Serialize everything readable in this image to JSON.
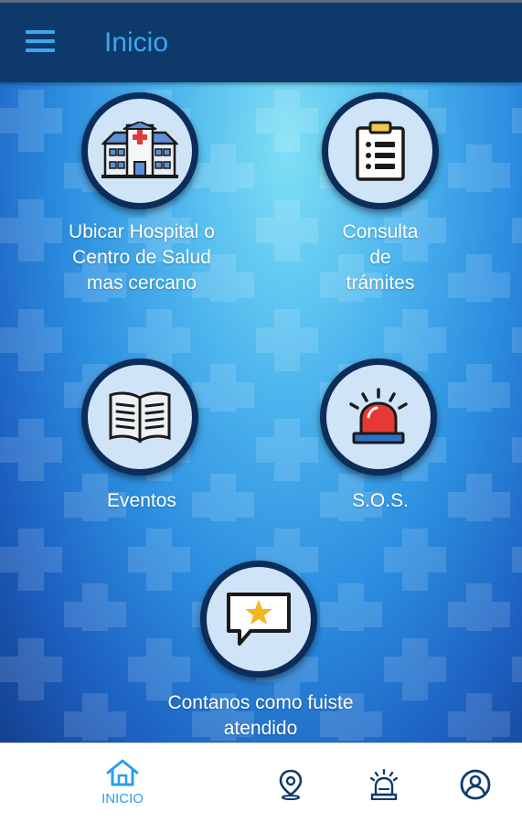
{
  "header": {
    "title": "Inicio",
    "menu_icon": "hamburger-menu-icon"
  },
  "tiles": [
    {
      "label_lines": [
        "Ubicar Hospital o",
        "Centro de Salud",
        "mas cercano"
      ],
      "icon": "hospital-icon"
    },
    {
      "label_lines": [
        "Consulta",
        "de",
        "trámites"
      ],
      "icon": "clipboard-icon"
    },
    {
      "label_lines": [
        "Eventos"
      ],
      "icon": "open-book-icon"
    },
    {
      "label_lines": [
        "S.O.S."
      ],
      "icon": "emergency-siren-icon"
    },
    {
      "label_lines": [
        "Contanos como fuiste",
        "atendido"
      ],
      "icon": "star-message-icon"
    }
  ],
  "bottom_nav": {
    "items": [
      {
        "label": "INICIO",
        "icon": "home-icon",
        "active": true
      },
      {
        "label": "",
        "icon": "location-pin-icon",
        "active": false
      },
      {
        "label": "",
        "icon": "siren-icon",
        "active": false
      },
      {
        "label": "",
        "icon": "user-profile-icon",
        "active": false
      }
    ]
  },
  "colors": {
    "header_bg": "#0e3a6b",
    "accent": "#3ba6f2",
    "circle_border": "#0c2d5a",
    "circle_fill": "#cfe4f7",
    "nav_icon": "#0e3a6b"
  }
}
